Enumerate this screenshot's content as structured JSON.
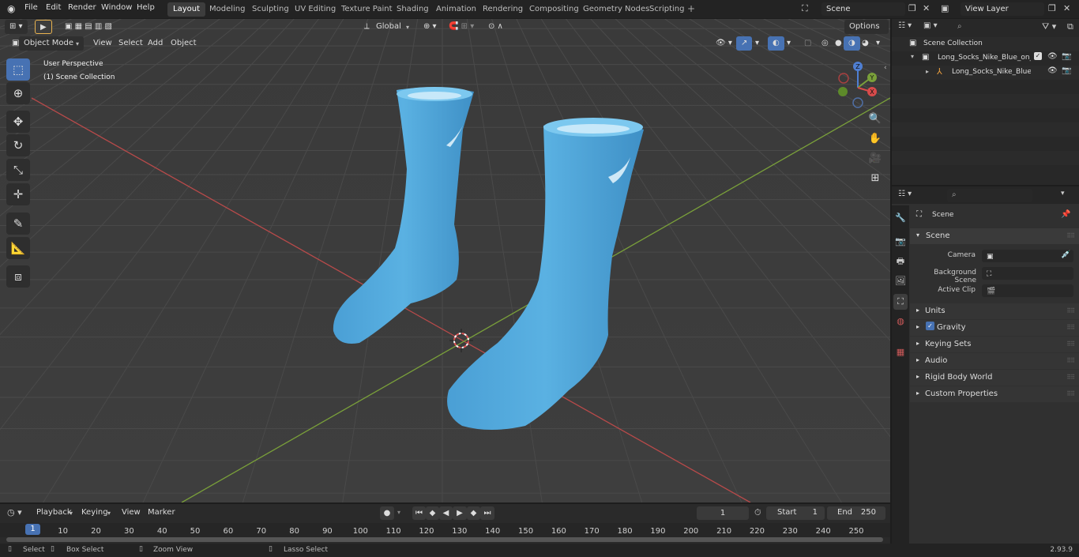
{
  "menus": [
    "File",
    "Edit",
    "Render",
    "Window",
    "Help"
  ],
  "workspaces": [
    "Layout",
    "Modeling",
    "Sculpting",
    "UV Editing",
    "Texture Paint",
    "Shading",
    "Animation",
    "Rendering",
    "Compositing",
    "Geometry Nodes",
    "Scripting"
  ],
  "active_workspace": "Layout",
  "scene_name": "Scene",
  "view_layer": "View Layer",
  "viewport": {
    "mode": "Object Mode",
    "menu": [
      "View",
      "Select",
      "Add",
      "Object"
    ],
    "orientation": "Global",
    "options_label": "Options",
    "overlay_title": "User Perspective",
    "overlay_subtitle": "(1) Scene Collection",
    "gizmo_labels": {
      "z": "Z",
      "y": "Y",
      "x": "X"
    }
  },
  "outliner": {
    "root": "Scene Collection",
    "items": [
      {
        "label": "Long_Socks_Nike_Blue_on_Th",
        "level": 1
      },
      {
        "label": "Long_Socks_Nike_Blue_c",
        "level": 2
      }
    ]
  },
  "properties": {
    "header": "Scene",
    "panel": "Scene",
    "fields": [
      {
        "label": "Camera",
        "value": ""
      },
      {
        "label": "Background Scene",
        "value": ""
      },
      {
        "label": "Active Clip",
        "value": ""
      }
    ],
    "subpanels": [
      "Units",
      "Gravity",
      "Keying Sets",
      "Audio",
      "Rigid Body World",
      "Custom Properties"
    ]
  },
  "timeline": {
    "menus": [
      "Playback",
      "Keying",
      "View",
      "Marker"
    ],
    "current_frame": "1",
    "start_label": "Start",
    "start": "1",
    "end_label": "End",
    "end": "250",
    "ticks": [
      "1",
      "10",
      "20",
      "30",
      "40",
      "50",
      "60",
      "70",
      "80",
      "90",
      "100",
      "110",
      "120",
      "130",
      "140",
      "150",
      "160",
      "170",
      "180",
      "190",
      "200",
      "210",
      "220",
      "230",
      "240",
      "250"
    ]
  },
  "status": {
    "select": "Select",
    "box_select": "Box Select",
    "zoom_view": "Zoom View",
    "lasso_select": "Lasso Select",
    "version": "2.93.9"
  },
  "colors": {
    "accent": "#4772b3",
    "sock": "#4da3d8",
    "x_axis": "#b84a4a",
    "y_axis": "#7aa03a"
  }
}
